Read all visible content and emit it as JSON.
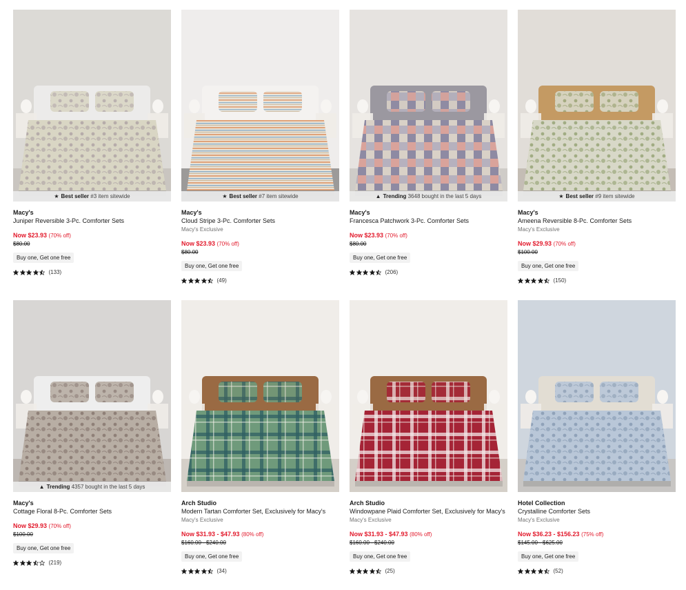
{
  "products": [
    {
      "brand": "Macy's",
      "title": "Juniper Reversible 3-Pc. Comforter Sets",
      "exclusive": "",
      "now": "Now $23.93",
      "pct": "(70% off)",
      "orig": "$80.00",
      "promo": "Buy one, Get one free",
      "rating": 4.5,
      "reviews": "(133)",
      "badge_label": "Best seller",
      "badge_text": "#3 item sitewide",
      "badge_icon": "award-icon",
      "palette": {
        "wall": "#dcdad6",
        "bed": "#d9d6c4",
        "pattern": "#a79aa0",
        "floor": "#c9c5c0",
        "head": "#ecebea"
      }
    },
    {
      "brand": "Macy's",
      "title": "Cloud Stripe 3-Pc. Comforter Sets",
      "exclusive": "Macy's Exclusive",
      "now": "Now $23.93",
      "pct": "(70% off)",
      "orig": "$80.00",
      "promo": "Buy one, Get one free",
      "rating": 4.5,
      "reviews": "(49)",
      "badge_label": "Best seller",
      "badge_text": "#7 item sitewide",
      "badge_icon": "award-icon",
      "palette": {
        "wall": "#efedec",
        "bed": "#e9e2d6",
        "pattern": "#e0a37a",
        "floor": "#9c9a99",
        "head": "#f4f2f0"
      }
    },
    {
      "brand": "Macy's",
      "title": "Francesca Patchwork 3-Pc. Comforter Sets",
      "exclusive": "",
      "now": "Now $23.93",
      "pct": "(70% off)",
      "orig": "$80.00",
      "promo": "Buy one, Get one free",
      "rating": 4.5,
      "reviews": "(206)",
      "badge_label": "Trending",
      "badge_text": "3648 bought in the last 5 days",
      "badge_icon": "flame-icon",
      "palette": {
        "wall": "#e6e3e0",
        "bed": "#b6b1be",
        "pattern": "#d9a39b",
        "floor": "#cfccc8",
        "head": "#9b98a0"
      }
    },
    {
      "brand": "Macy's",
      "title": "Ameena Reversible 8-Pc. Comforter Sets",
      "exclusive": "Macy's Exclusive",
      "now": "Now $29.93",
      "pct": "(70% off)",
      "orig": "$100.00",
      "promo": "Buy one, Get one free",
      "rating": 4.5,
      "reviews": "(150)",
      "badge_label": "Best seller",
      "badge_text": "#9 item sitewide",
      "badge_icon": "award-icon",
      "palette": {
        "wall": "#e1ddd8",
        "bed": "#d8d8c8",
        "pattern": "#8a9a66",
        "floor": "#c4bdb5",
        "head": "#c49a63"
      }
    },
    {
      "brand": "Macy's",
      "title": "Cottage Floral 8-Pc. Comforter Sets",
      "exclusive": "",
      "now": "Now $29.93",
      "pct": "(70% off)",
      "orig": "$100.00",
      "promo": "Buy one, Get one free",
      "rating": 3.5,
      "reviews": "(219)",
      "badge_label": "Trending",
      "badge_text": "4357 bought in the last 5 days",
      "badge_icon": "flame-icon",
      "palette": {
        "wall": "#d8d6d4",
        "bed": "#b8aea4",
        "pattern": "#7d6d66",
        "floor": "#bdb7b2",
        "head": "#eeeeee"
      }
    },
    {
      "brand": "Arch Studio",
      "title": "Modern Tartan Comforter Set, Exclusively for Macy's",
      "exclusive": "Macy's Exclusive",
      "now": "Now $31.93 - $47.93",
      "pct": "(80% off)",
      "orig": "$160.00 - $240.00",
      "promo": "Buy one, Get one free",
      "rating": 4.5,
      "reviews": "(34)",
      "badge_label": "",
      "badge_text": "",
      "badge_icon": "",
      "palette": {
        "wall": "#f0ede9",
        "bed": "#6f9a7b",
        "pattern": "#2f5f63",
        "floor": "#d4cfc8",
        "head": "#9a6a43"
      }
    },
    {
      "brand": "Arch Studio",
      "title": "Windowpane Plaid Comforter Set, Exclusively for Macy's",
      "exclusive": "Macy's Exclusive",
      "now": "Now $31.93 - $47.93",
      "pct": "(80% off)",
      "orig": "$160.00 - $240.00",
      "promo": "Buy one, Get one free",
      "rating": 4.5,
      "reviews": "(25)",
      "badge_label": "",
      "badge_text": "",
      "badge_icon": "",
      "palette": {
        "wall": "#f0ede9",
        "bed": "#a52436",
        "pattern": "#f3e6e6",
        "floor": "#d4cfc8",
        "head": "#9a6a43"
      }
    },
    {
      "brand": "Hotel Collection",
      "title": "Crystalline Comforter Sets",
      "exclusive": "Macy's Exclusive",
      "now": "Now $36.23 - $156.23",
      "pct": "(75% off)",
      "orig": "$145.00 - $625.00",
      "promo": "Buy one, Get one free",
      "rating": 4.5,
      "reviews": "(52)",
      "badge_label": "",
      "badge_text": "",
      "badge_icon": "",
      "palette": {
        "wall": "#cfd6de",
        "bed": "#b9c7d8",
        "pattern": "#7f93ad",
        "floor": "#c8c6c4",
        "head": "#e2ddd3"
      }
    }
  ]
}
